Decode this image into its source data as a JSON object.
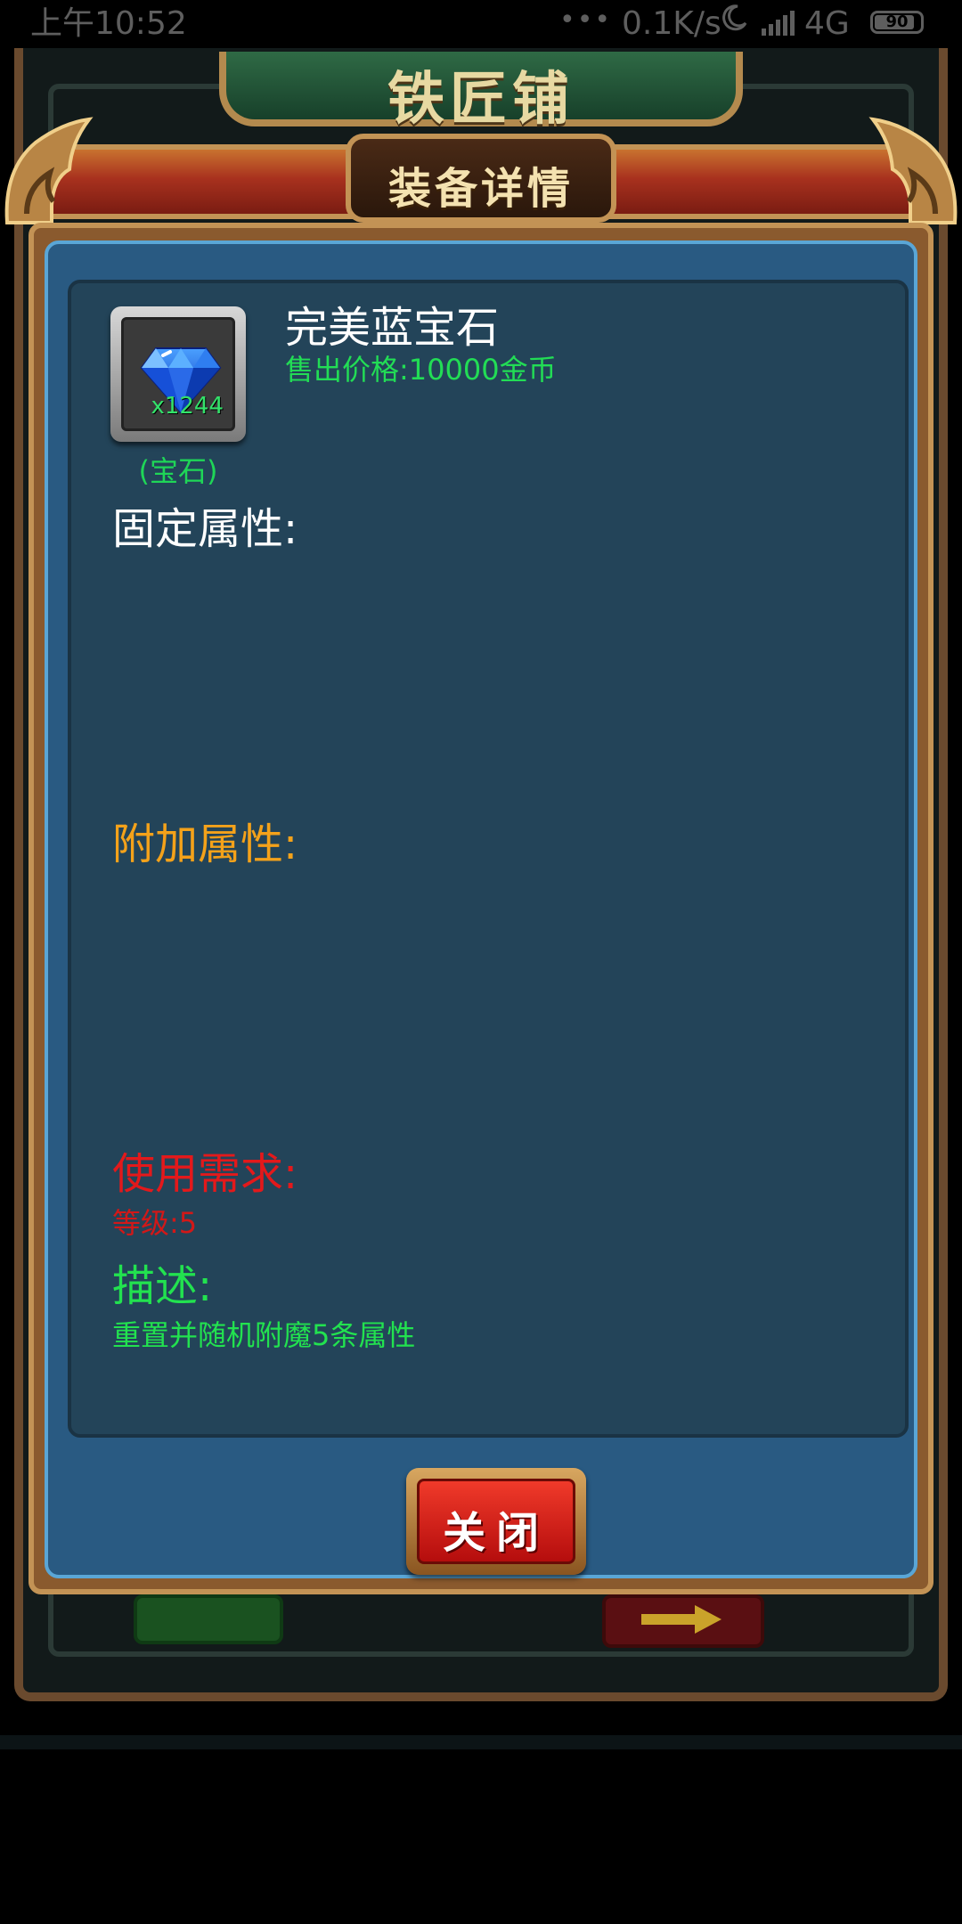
{
  "status_bar": {
    "time": "上午10:52",
    "dots": "•••",
    "network_speed": "0.1K/s",
    "network_type": "4G",
    "battery": "90",
    "icon_moon": "moon-icon",
    "icon_signal": "signal-icon"
  },
  "shop": {
    "title": "铁匠铺"
  },
  "modal": {
    "title": "装备详情",
    "item": {
      "icon": "blue-gem-icon",
      "name": "完美蓝宝石",
      "count": "x1244",
      "type": "(宝石)",
      "sell_price": "售出价格:10000金币"
    },
    "fixed_attributes_label": "固定属性:",
    "extra_attributes_label": "附加属性:",
    "requirements_label": "使用需求:",
    "requirement_level": "等级:5",
    "description_label": "描述:",
    "description_text": "重置并随机附魔5条属性",
    "close_button": "关闭"
  },
  "colors": {
    "panel_blue": "#234459",
    "modal_blue": "#295a82",
    "frame_brown": "#8a5a2e",
    "gold_trim": "#c39355",
    "green_text": "#22e24f",
    "orange_text": "#f4a21a",
    "red_text": "#e3191b",
    "button_red": "#d42219"
  }
}
